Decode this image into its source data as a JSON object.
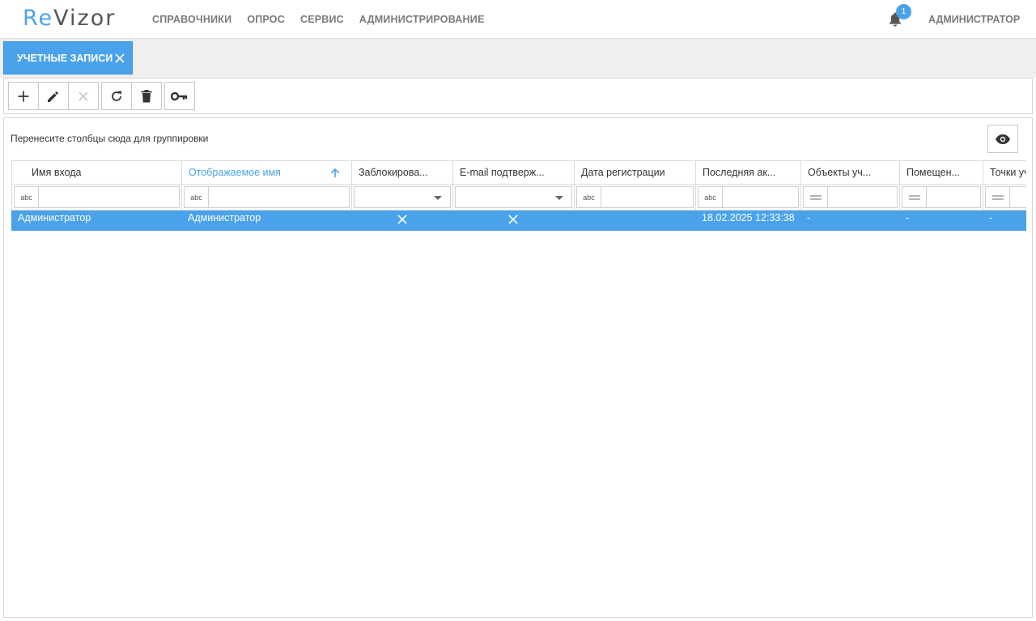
{
  "header": {
    "logo_prefix": "Re",
    "logo_suffix": "Vizor",
    "nav": [
      "СПРАВОЧНИКИ",
      "ОПРОС",
      "СЕРВИС",
      "АДМИНИСТРИРОВАНИЕ"
    ],
    "notification_count": "1",
    "user": "АДМИНИСТРАТОР"
  },
  "tab": {
    "label": "УЧЕТНЫЕ ЗАПИСИ"
  },
  "toolbar": {
    "buttons": [
      {
        "icon": "plus-icon"
      },
      {
        "icon": "pencil-icon"
      },
      {
        "icon": "close-icon",
        "disabled": true
      },
      {
        "icon": "refresh-icon"
      },
      {
        "icon": "trash-icon"
      },
      {
        "icon": "key-icon"
      }
    ]
  },
  "grid": {
    "group_hint": "Перенесите столбцы сюда для группировки",
    "columns": [
      "Имя входа",
      "Отображаемое имя",
      "Заблокирова...",
      "E-mail подтверж...",
      "Дата регистрации",
      "Последняя ак...",
      "Объекты уч...",
      "Помещен...",
      "Точки уч"
    ],
    "sorted_column": "Отображаемое имя",
    "filter_ops": [
      "abc",
      "abc",
      "",
      "",
      "abc",
      "abc",
      "=",
      "=",
      "="
    ],
    "rows": [
      {
        "login": "Администратор",
        "display_name": "Администратор",
        "blocked": "✕",
        "email_confirmed": "✕",
        "registered": "",
        "last_activity": "18.02.2025 12:33:38",
        "objects": "-",
        "rooms": "-",
        "points": "-"
      }
    ]
  },
  "colors": {
    "accent": "#4aa3ea"
  }
}
